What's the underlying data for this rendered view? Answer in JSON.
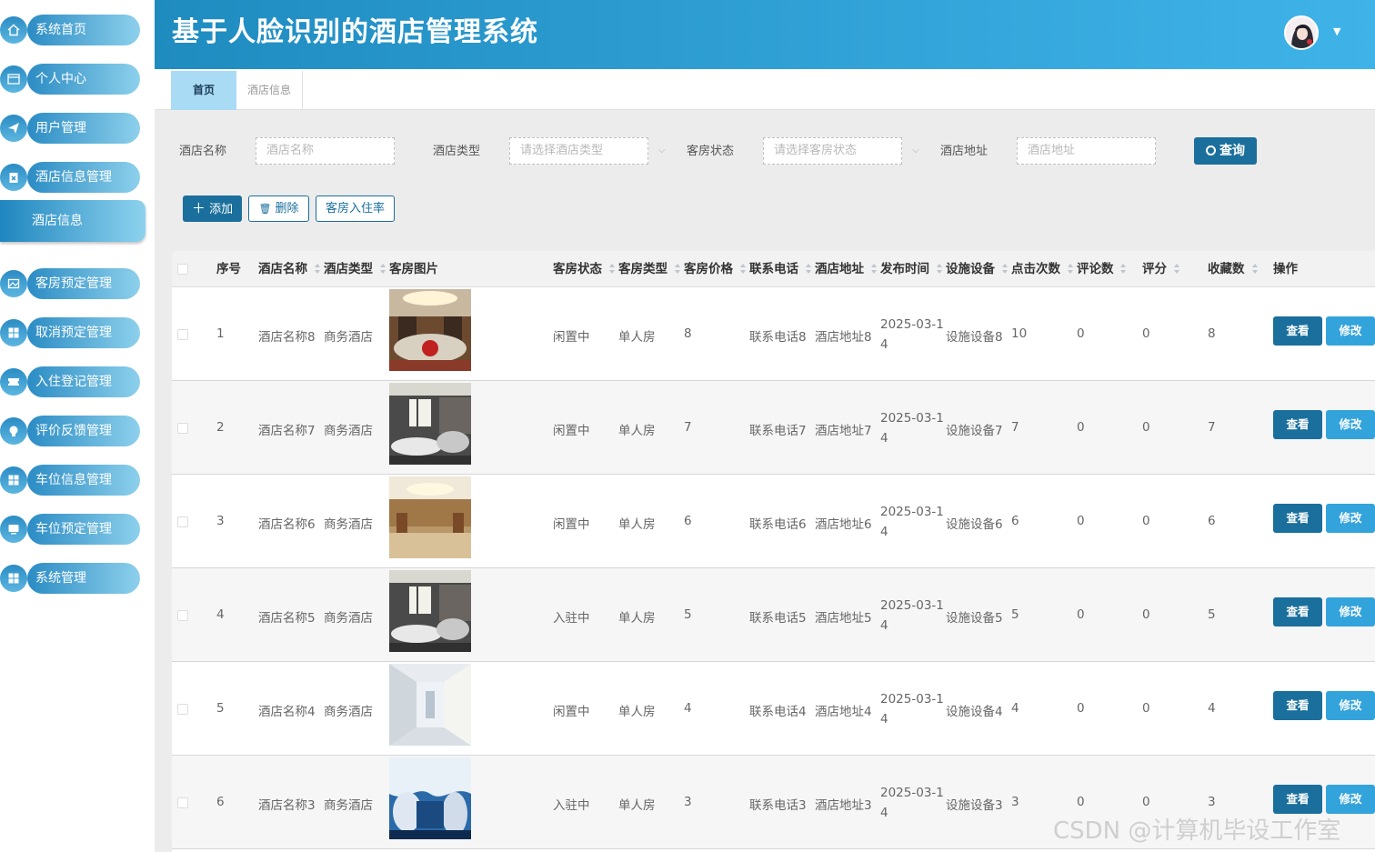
{
  "header": {
    "title": "基于人脸识别的酒店管理系统"
  },
  "sidebar": {
    "items": [
      {
        "label": "系统首页",
        "icon": "home-icon"
      },
      {
        "label": "个人中心",
        "icon": "id-card-icon"
      },
      {
        "label": "用户管理",
        "icon": "send-icon"
      },
      {
        "label": "酒店信息管理",
        "icon": "clipboard-icon"
      },
      {
        "label": "客房预定管理",
        "icon": "image-icon"
      },
      {
        "label": "取消预定管理",
        "icon": "grid-icon"
      },
      {
        "label": "入住登记管理",
        "icon": "ticket-icon"
      },
      {
        "label": "评价反馈管理",
        "icon": "bulb-icon"
      },
      {
        "label": "车位信息管理",
        "icon": "grid-icon"
      },
      {
        "label": "车位预定管理",
        "icon": "monitor-icon"
      },
      {
        "label": "系统管理",
        "icon": "grid-icon"
      }
    ],
    "sub_item": "酒店信息"
  },
  "tabs": {
    "home": "首页",
    "current": "酒店信息"
  },
  "search": {
    "name_label": "酒店名称",
    "name_placeholder": "酒店名称",
    "type_label": "酒店类型",
    "type_placeholder": "请选择酒店类型",
    "status_label": "客房状态",
    "status_placeholder": "请选择客房状态",
    "address_label": "酒店地址",
    "address_placeholder": "酒店地址",
    "search_button": "查询"
  },
  "actions": {
    "add": "添加",
    "delete": "删除",
    "occupancy": "客房入住率"
  },
  "table": {
    "headers": {
      "index": "序号",
      "name": "酒店名称",
      "type": "酒店类型",
      "image": "客房图片",
      "status": "客房状态",
      "room_type": "客房类型",
      "price": "客房价格",
      "phone": "联系电话",
      "address": "酒店地址",
      "publish_time": "发布时间",
      "facilities": "设施设备",
      "clicks": "点击次数",
      "comments": "评论数",
      "rating": "评分",
      "favorites": "收藏数",
      "ops": "操作"
    },
    "view_label": "查看",
    "edit_label": "修改",
    "rows": [
      {
        "index": "1",
        "name": "酒店名称8",
        "type": "商务酒店",
        "status": "闲置中",
        "room_type": "单人房",
        "price": "8",
        "phone": "联系电话8",
        "address": "酒店地址8",
        "date1": "2025-03-1",
        "date2": "4",
        "facilities": "设施设备8",
        "clicks": "10",
        "comments": "0",
        "rating": "0",
        "favorites": "8"
      },
      {
        "index": "2",
        "name": "酒店名称7",
        "type": "商务酒店",
        "status": "闲置中",
        "room_type": "单人房",
        "price": "7",
        "phone": "联系电话7",
        "address": "酒店地址7",
        "date1": "2025-03-1",
        "date2": "4",
        "facilities": "设施设备7",
        "clicks": "7",
        "comments": "0",
        "rating": "0",
        "favorites": "7"
      },
      {
        "index": "3",
        "name": "酒店名称6",
        "type": "商务酒店",
        "status": "闲置中",
        "room_type": "单人房",
        "price": "6",
        "phone": "联系电话6",
        "address": "酒店地址6",
        "date1": "2025-03-1",
        "date2": "4",
        "facilities": "设施设备6",
        "clicks": "6",
        "comments": "0",
        "rating": "0",
        "favorites": "6"
      },
      {
        "index": "4",
        "name": "酒店名称5",
        "type": "商务酒店",
        "status": "入驻中",
        "room_type": "单人房",
        "price": "5",
        "phone": "联系电话5",
        "address": "酒店地址5",
        "date1": "2025-03-1",
        "date2": "4",
        "facilities": "设施设备5",
        "clicks": "5",
        "comments": "0",
        "rating": "0",
        "favorites": "5"
      },
      {
        "index": "5",
        "name": "酒店名称4",
        "type": "商务酒店",
        "status": "闲置中",
        "room_type": "单人房",
        "price": "4",
        "phone": "联系电话4",
        "address": "酒店地址4",
        "date1": "2025-03-1",
        "date2": "4",
        "facilities": "设施设备4",
        "clicks": "4",
        "comments": "0",
        "rating": "0",
        "favorites": "4"
      },
      {
        "index": "6",
        "name": "酒店名称3",
        "type": "商务酒店",
        "status": "入驻中",
        "room_type": "单人房",
        "price": "3",
        "phone": "联系电话3",
        "address": "酒店地址3",
        "date1": "2025-03-1",
        "date2": "4",
        "facilities": "设施设备3",
        "clicks": "3",
        "comments": "0",
        "rating": "0",
        "favorites": "3"
      }
    ]
  },
  "watermark": "CSDN @计算机毕设工作室",
  "colors": {
    "primary": "#1a6f9c",
    "secondary": "#33a3dc",
    "header_start": "#1f8cc0",
    "header_end": "#3fb3e8"
  }
}
